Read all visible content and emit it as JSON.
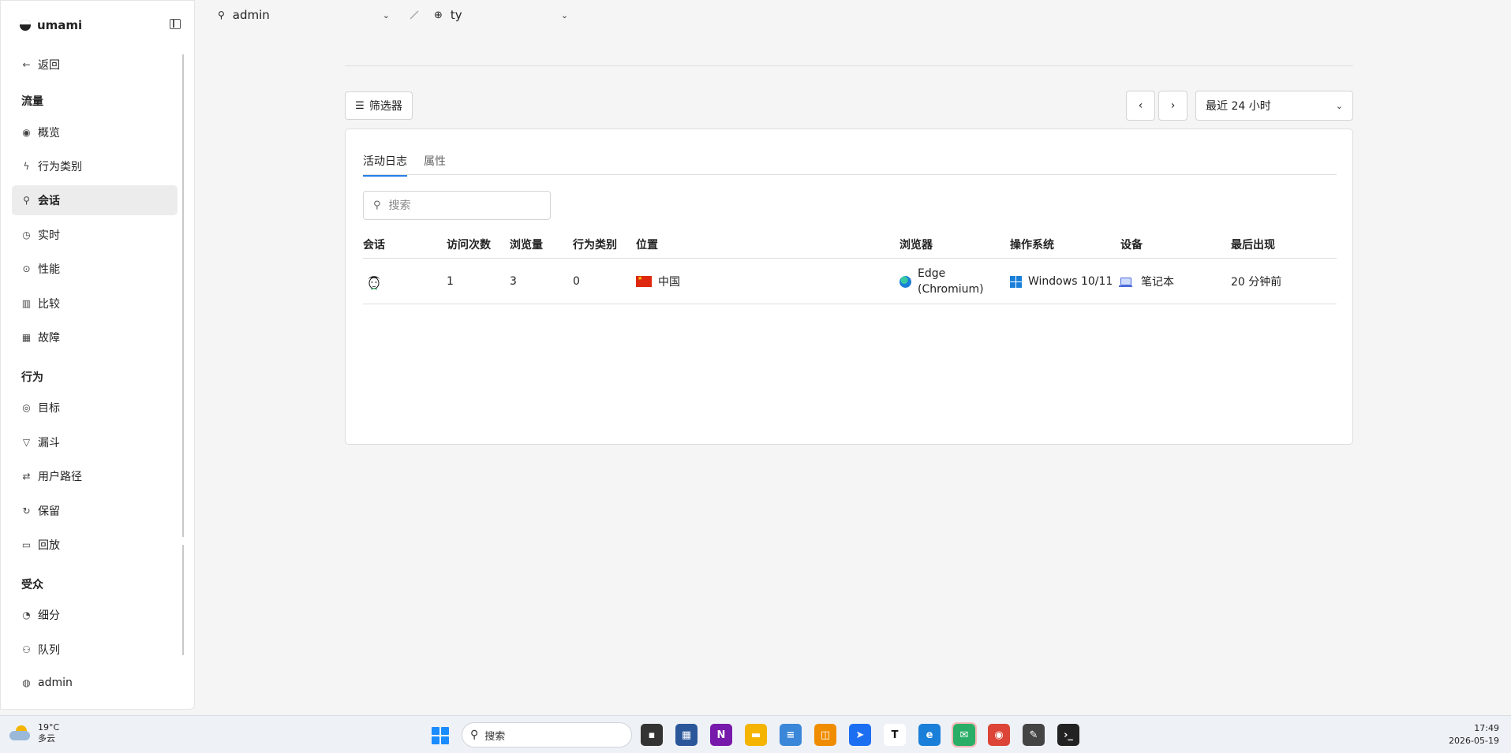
{
  "sidebar": {
    "brand": "umami",
    "back": "返回",
    "sections": {
      "traffic": "流量",
      "behavior": "行为",
      "audience": "受众"
    },
    "items": [
      {
        "label": "概览",
        "icon": "eye-icon"
      },
      {
        "label": "行为类别",
        "icon": "lightning-icon"
      },
      {
        "label": "会话",
        "icon": "user-icon"
      },
      {
        "label": "实时",
        "icon": "clock-icon"
      },
      {
        "label": "性能",
        "icon": "gauge-icon"
      },
      {
        "label": "比较",
        "icon": "bar-chart-icon"
      },
      {
        "label": "故障",
        "icon": "grid-icon"
      },
      {
        "label": "目标",
        "icon": "target-icon"
      },
      {
        "label": "漏斗",
        "icon": "funnel-icon"
      },
      {
        "label": "用户路径",
        "icon": "path-icon"
      },
      {
        "label": "保留",
        "icon": "retention-icon"
      },
      {
        "label": "回放",
        "icon": "video-icon"
      },
      {
        "label": "细分",
        "icon": "pie-icon"
      },
      {
        "label": "队列",
        "icon": "user-plus-icon"
      }
    ],
    "user": "admin"
  },
  "topbar": {
    "team": "admin",
    "website": "ty"
  },
  "toolbar": {
    "filter": "筛选器",
    "date_range": "最近 24 小时"
  },
  "tabs": [
    {
      "label": "活动日志",
      "active": true
    },
    {
      "label": "属性",
      "active": false
    }
  ],
  "search": {
    "placeholder": "搜索"
  },
  "table": {
    "headers": [
      "会话",
      "访问次数",
      "浏览量",
      "行为类别",
      "位置",
      "浏览器",
      "操作系统",
      "设备",
      "最后出现"
    ],
    "rows": [
      {
        "visits": "1",
        "views": "3",
        "events": "0",
        "location": "中国",
        "browser_line1": "Edge",
        "browser_line2": "(Chromium)",
        "os": "Windows 10/11",
        "device": "笔记本",
        "last_seen": "20 分钟前"
      }
    ]
  },
  "taskbar": {
    "temp": "19°C",
    "weather": "多云",
    "search": "搜索",
    "time": "17:49",
    "date": "2026-05-19"
  },
  "colors": {
    "accent": "#2680eb",
    "active_nav": "#ececec"
  }
}
